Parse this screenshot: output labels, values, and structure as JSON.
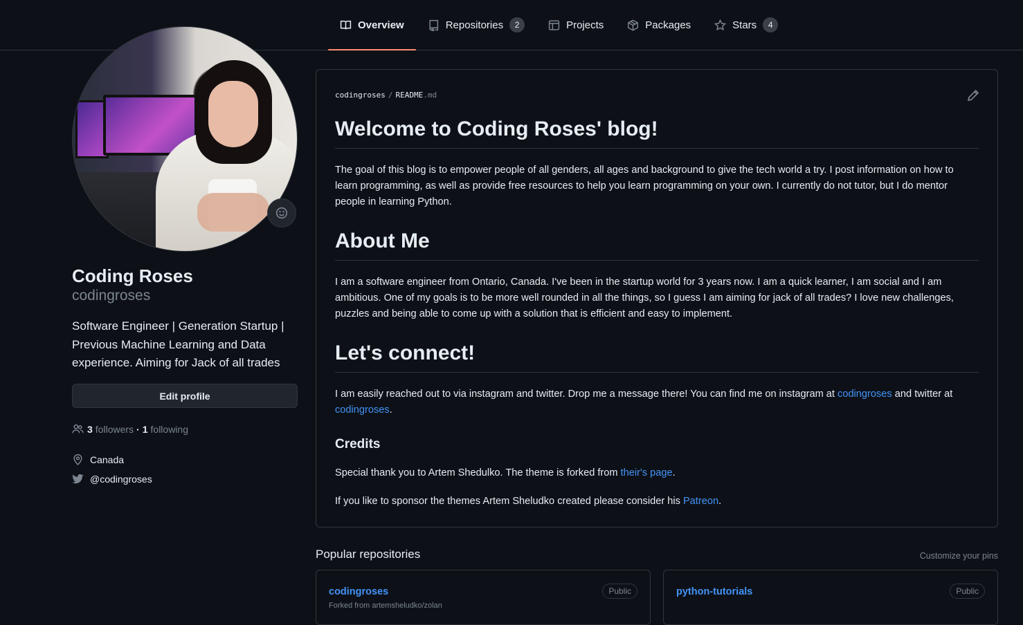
{
  "nav": {
    "tabs": [
      {
        "label": "Overview",
        "icon": "book-icon"
      },
      {
        "label": "Repositories",
        "icon": "repo-icon",
        "count": "2"
      },
      {
        "label": "Projects",
        "icon": "table-icon"
      },
      {
        "label": "Packages",
        "icon": "package-icon"
      },
      {
        "label": "Stars",
        "icon": "star-icon",
        "count": "4"
      }
    ]
  },
  "profile": {
    "name": "Coding Roses",
    "login": "codingroses",
    "bio": "Software Engineer | Generation Startup | Previous Machine Learning and Data experience. Aiming for Jack of all trades",
    "edit_label": "Edit profile",
    "followers_count": "3",
    "followers_label": "followers",
    "dot": "·",
    "following_count": "1",
    "following_label": "following",
    "location": "Canada",
    "twitter": "@codingroses"
  },
  "readme": {
    "owner": "codingroses",
    "sep": "/",
    "file": "README",
    "ext": ".md",
    "h1": "Welcome to Coding Roses' blog!",
    "p1": "The goal of this blog is to empower people of all genders, all ages and background to give the tech world a try. I post information on how to learn programming, as well as provide free resources to help you learn programming on your own. I currently do not tutor, but I do mentor people in learning Python.",
    "h2": "About Me",
    "p2": "I am a software engineer from Ontario, Canada. I've been in the startup world for 3 years now. I am a quick learner, I am social and I am ambitious. One of my goals is to be more well rounded in all the things, so I guess I am aiming for jack of all trades? I love new challenges, puzzles and being able to come up with a solution that is efficient and easy to implement.",
    "h3": "Let's connect!",
    "p3_a": "I am easily reached out to via instagram and twitter. Drop me a message there! You can find me on instagram at ",
    "p3_link1": "codingroses",
    "p3_b": " and twitter at ",
    "p3_link2": "codingroses",
    "p3_c": ".",
    "h4": "Credits",
    "p4_a": "Special thank you to Artem Shedulko. The theme is forked from ",
    "p4_link": "their's page",
    "p4_b": ".",
    "p5_a": "If you like to sponsor the themes Artem Sheludko created please consider his ",
    "p5_link": "Patreon",
    "p5_b": "."
  },
  "popular": {
    "title": "Popular repositories",
    "customize": "Customize your pins",
    "repos": [
      {
        "name": "codingroses",
        "visibility": "Public",
        "forked": "Forked from artemsheludko/zolan"
      },
      {
        "name": "python-tutorials",
        "visibility": "Public"
      }
    ]
  },
  "colors": {
    "background": "#0d1117",
    "border": "#30363d",
    "link": "#4493f8",
    "active_tab_underline": "#fd8c73",
    "muted": "#7d8590"
  }
}
